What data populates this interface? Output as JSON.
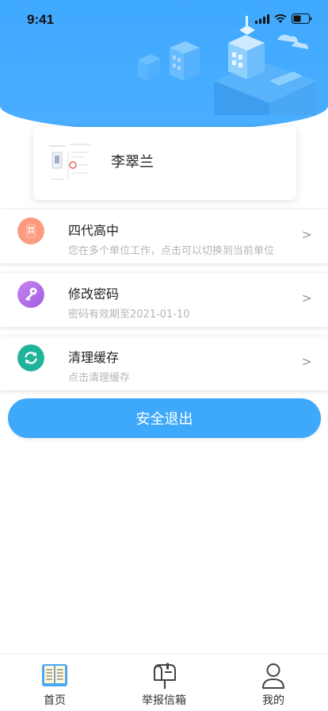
{
  "status_bar": {
    "time": "9:41"
  },
  "profile": {
    "name": "李翠兰"
  },
  "menu": [
    {
      "title": "四代高中",
      "subtitle": "您在多个单位工作，点击可以切换到当前单位",
      "icon": "building-icon",
      "color": "#fb9a7f"
    },
    {
      "title": "修改密码",
      "subtitle": "密码有效期至2021-01-10",
      "icon": "key-icon",
      "color": "#b56ee8"
    },
    {
      "title": "清理缓存",
      "subtitle": "点击清理缓存",
      "icon": "refresh-icon",
      "color": "#1fb39a"
    }
  ],
  "chevron": ">",
  "logout_label": "安全退出",
  "tabs": [
    {
      "label": "首页",
      "icon": "book-icon"
    },
    {
      "label": "举报信箱",
      "icon": "mailbox-icon"
    },
    {
      "label": "我的",
      "icon": "user-icon"
    }
  ],
  "colors": {
    "primary": "#3ea9fb",
    "header": "#3fa9ff"
  }
}
